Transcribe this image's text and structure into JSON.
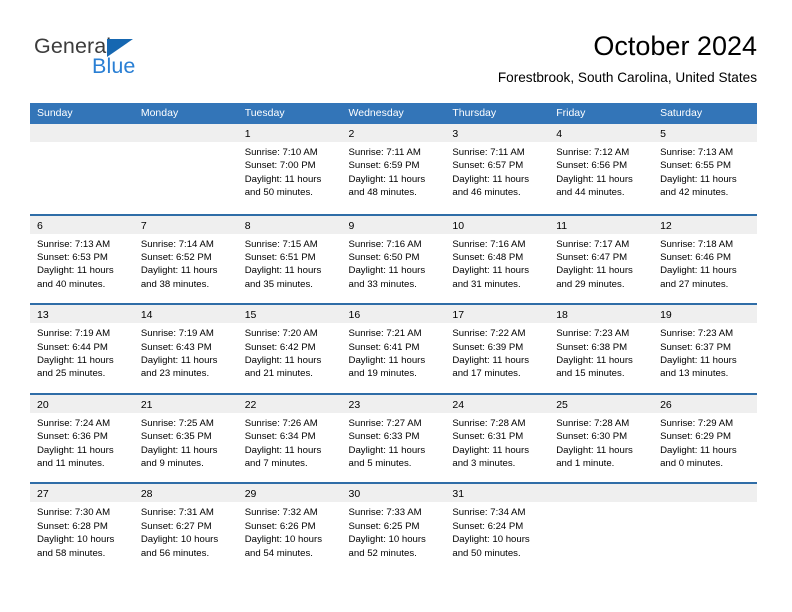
{
  "brand": {
    "name_part1": "General",
    "name_part2": "Blue",
    "triangle_icon": "triangle-icon",
    "accent_blue": "#2a7fd4",
    "logo_triangle_color": "#1667b1"
  },
  "header": {
    "title": "October 2024",
    "location": "Forestbrook, South Carolina, United States"
  },
  "theme": {
    "header_blue": "#3375b8",
    "row_divider_blue": "#2f6da7",
    "day_band_gray": "#efefef"
  },
  "calendar": {
    "weekday_headers": [
      "Sunday",
      "Monday",
      "Tuesday",
      "Wednesday",
      "Thursday",
      "Friday",
      "Saturday"
    ],
    "weeks": [
      [
        {
          "day": "",
          "sunrise": "",
          "sunset": "",
          "daylight_line1": "",
          "daylight_line2": ""
        },
        {
          "day": "",
          "sunrise": "",
          "sunset": "",
          "daylight_line1": "",
          "daylight_line2": ""
        },
        {
          "day": "1",
          "sunrise": "Sunrise: 7:10 AM",
          "sunset": "Sunset: 7:00 PM",
          "daylight_line1": "Daylight: 11 hours",
          "daylight_line2": "and 50 minutes."
        },
        {
          "day": "2",
          "sunrise": "Sunrise: 7:11 AM",
          "sunset": "Sunset: 6:59 PM",
          "daylight_line1": "Daylight: 11 hours",
          "daylight_line2": "and 48 minutes."
        },
        {
          "day": "3",
          "sunrise": "Sunrise: 7:11 AM",
          "sunset": "Sunset: 6:57 PM",
          "daylight_line1": "Daylight: 11 hours",
          "daylight_line2": "and 46 minutes."
        },
        {
          "day": "4",
          "sunrise": "Sunrise: 7:12 AM",
          "sunset": "Sunset: 6:56 PM",
          "daylight_line1": "Daylight: 11 hours",
          "daylight_line2": "and 44 minutes."
        },
        {
          "day": "5",
          "sunrise": "Sunrise: 7:13 AM",
          "sunset": "Sunset: 6:55 PM",
          "daylight_line1": "Daylight: 11 hours",
          "daylight_line2": "and 42 minutes."
        }
      ],
      [
        {
          "day": "6",
          "sunrise": "Sunrise: 7:13 AM",
          "sunset": "Sunset: 6:53 PM",
          "daylight_line1": "Daylight: 11 hours",
          "daylight_line2": "and 40 minutes."
        },
        {
          "day": "7",
          "sunrise": "Sunrise: 7:14 AM",
          "sunset": "Sunset: 6:52 PM",
          "daylight_line1": "Daylight: 11 hours",
          "daylight_line2": "and 38 minutes."
        },
        {
          "day": "8",
          "sunrise": "Sunrise: 7:15 AM",
          "sunset": "Sunset: 6:51 PM",
          "daylight_line1": "Daylight: 11 hours",
          "daylight_line2": "and 35 minutes."
        },
        {
          "day": "9",
          "sunrise": "Sunrise: 7:16 AM",
          "sunset": "Sunset: 6:50 PM",
          "daylight_line1": "Daylight: 11 hours",
          "daylight_line2": "and 33 minutes."
        },
        {
          "day": "10",
          "sunrise": "Sunrise: 7:16 AM",
          "sunset": "Sunset: 6:48 PM",
          "daylight_line1": "Daylight: 11 hours",
          "daylight_line2": "and 31 minutes."
        },
        {
          "day": "11",
          "sunrise": "Sunrise: 7:17 AM",
          "sunset": "Sunset: 6:47 PM",
          "daylight_line1": "Daylight: 11 hours",
          "daylight_line2": "and 29 minutes."
        },
        {
          "day": "12",
          "sunrise": "Sunrise: 7:18 AM",
          "sunset": "Sunset: 6:46 PM",
          "daylight_line1": "Daylight: 11 hours",
          "daylight_line2": "and 27 minutes."
        }
      ],
      [
        {
          "day": "13",
          "sunrise": "Sunrise: 7:19 AM",
          "sunset": "Sunset: 6:44 PM",
          "daylight_line1": "Daylight: 11 hours",
          "daylight_line2": "and 25 minutes."
        },
        {
          "day": "14",
          "sunrise": "Sunrise: 7:19 AM",
          "sunset": "Sunset: 6:43 PM",
          "daylight_line1": "Daylight: 11 hours",
          "daylight_line2": "and 23 minutes."
        },
        {
          "day": "15",
          "sunrise": "Sunrise: 7:20 AM",
          "sunset": "Sunset: 6:42 PM",
          "daylight_line1": "Daylight: 11 hours",
          "daylight_line2": "and 21 minutes."
        },
        {
          "day": "16",
          "sunrise": "Sunrise: 7:21 AM",
          "sunset": "Sunset: 6:41 PM",
          "daylight_line1": "Daylight: 11 hours",
          "daylight_line2": "and 19 minutes."
        },
        {
          "day": "17",
          "sunrise": "Sunrise: 7:22 AM",
          "sunset": "Sunset: 6:39 PM",
          "daylight_line1": "Daylight: 11 hours",
          "daylight_line2": "and 17 minutes."
        },
        {
          "day": "18",
          "sunrise": "Sunrise: 7:23 AM",
          "sunset": "Sunset: 6:38 PM",
          "daylight_line1": "Daylight: 11 hours",
          "daylight_line2": "and 15 minutes."
        },
        {
          "day": "19",
          "sunrise": "Sunrise: 7:23 AM",
          "sunset": "Sunset: 6:37 PM",
          "daylight_line1": "Daylight: 11 hours",
          "daylight_line2": "and 13 minutes."
        }
      ],
      [
        {
          "day": "20",
          "sunrise": "Sunrise: 7:24 AM",
          "sunset": "Sunset: 6:36 PM",
          "daylight_line1": "Daylight: 11 hours",
          "daylight_line2": "and 11 minutes."
        },
        {
          "day": "21",
          "sunrise": "Sunrise: 7:25 AM",
          "sunset": "Sunset: 6:35 PM",
          "daylight_line1": "Daylight: 11 hours",
          "daylight_line2": "and 9 minutes."
        },
        {
          "day": "22",
          "sunrise": "Sunrise: 7:26 AM",
          "sunset": "Sunset: 6:34 PM",
          "daylight_line1": "Daylight: 11 hours",
          "daylight_line2": "and 7 minutes."
        },
        {
          "day": "23",
          "sunrise": "Sunrise: 7:27 AM",
          "sunset": "Sunset: 6:33 PM",
          "daylight_line1": "Daylight: 11 hours",
          "daylight_line2": "and 5 minutes."
        },
        {
          "day": "24",
          "sunrise": "Sunrise: 7:28 AM",
          "sunset": "Sunset: 6:31 PM",
          "daylight_line1": "Daylight: 11 hours",
          "daylight_line2": "and 3 minutes."
        },
        {
          "day": "25",
          "sunrise": "Sunrise: 7:28 AM",
          "sunset": "Sunset: 6:30 PM",
          "daylight_line1": "Daylight: 11 hours",
          "daylight_line2": "and 1 minute."
        },
        {
          "day": "26",
          "sunrise": "Sunrise: 7:29 AM",
          "sunset": "Sunset: 6:29 PM",
          "daylight_line1": "Daylight: 11 hours",
          "daylight_line2": "and 0 minutes."
        }
      ],
      [
        {
          "day": "27",
          "sunrise": "Sunrise: 7:30 AM",
          "sunset": "Sunset: 6:28 PM",
          "daylight_line1": "Daylight: 10 hours",
          "daylight_line2": "and 58 minutes."
        },
        {
          "day": "28",
          "sunrise": "Sunrise: 7:31 AM",
          "sunset": "Sunset: 6:27 PM",
          "daylight_line1": "Daylight: 10 hours",
          "daylight_line2": "and 56 minutes."
        },
        {
          "day": "29",
          "sunrise": "Sunrise: 7:32 AM",
          "sunset": "Sunset: 6:26 PM",
          "daylight_line1": "Daylight: 10 hours",
          "daylight_line2": "and 54 minutes."
        },
        {
          "day": "30",
          "sunrise": "Sunrise: 7:33 AM",
          "sunset": "Sunset: 6:25 PM",
          "daylight_line1": "Daylight: 10 hours",
          "daylight_line2": "and 52 minutes."
        },
        {
          "day": "31",
          "sunrise": "Sunrise: 7:34 AM",
          "sunset": "Sunset: 6:24 PM",
          "daylight_line1": "Daylight: 10 hours",
          "daylight_line2": "and 50 minutes."
        },
        {
          "day": "",
          "sunrise": "",
          "sunset": "",
          "daylight_line1": "",
          "daylight_line2": ""
        },
        {
          "day": "",
          "sunrise": "",
          "sunset": "",
          "daylight_line1": "",
          "daylight_line2": ""
        }
      ]
    ]
  }
}
